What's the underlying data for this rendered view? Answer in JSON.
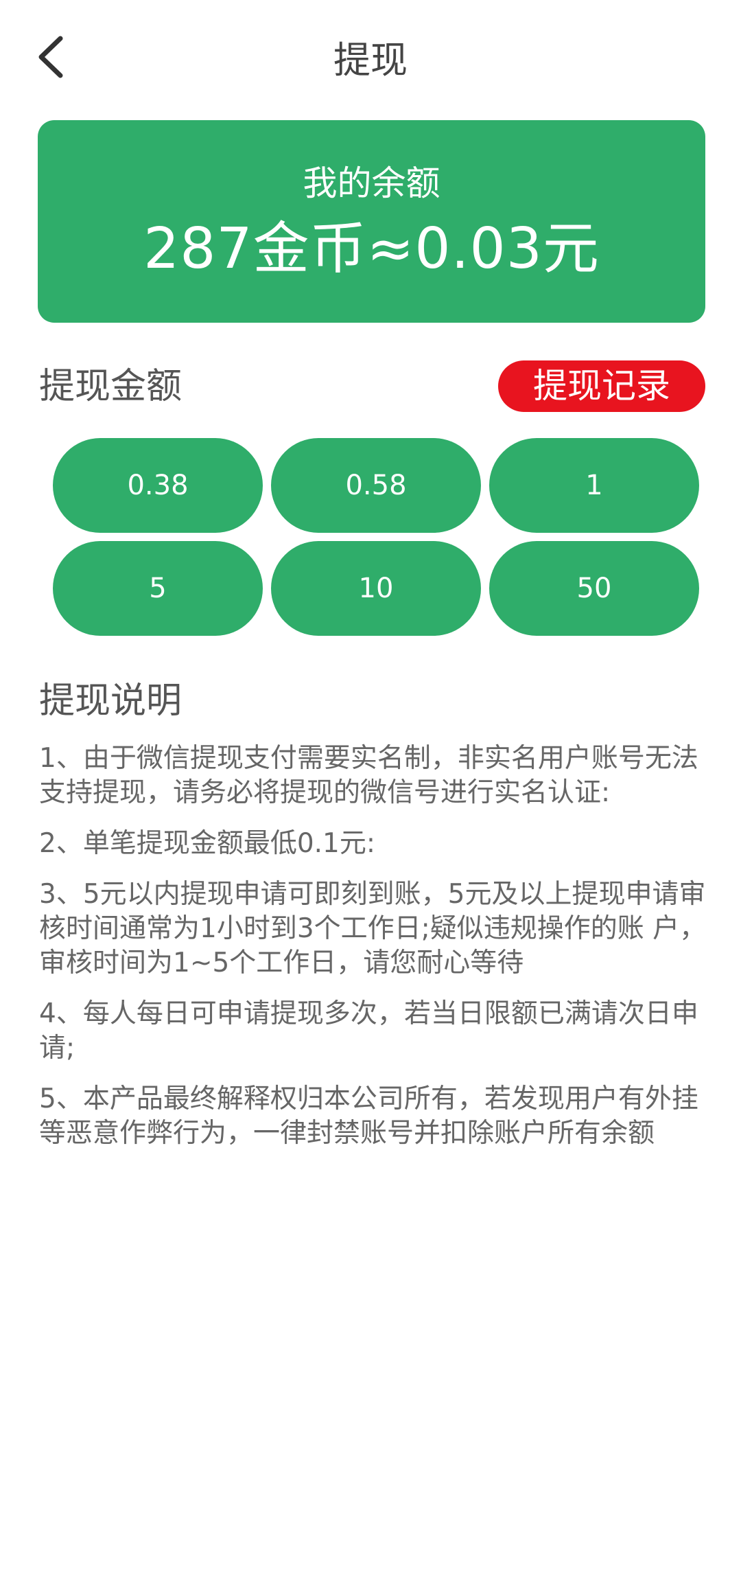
{
  "header": {
    "title": "提现",
    "back_icon": "chevron-left-icon"
  },
  "balance": {
    "label": "我的余额",
    "value": "287金币≈0.03元"
  },
  "amount_section": {
    "title": "提现金额",
    "records_label": "提现记录",
    "options": [
      "0.38",
      "0.58",
      "1",
      "5",
      "10",
      "50"
    ]
  },
  "description": {
    "title": "提现说明",
    "items": [
      "1、由于微信提现支付需要实名制，非实名用户账号无法支持提现，请务必将提现的微信号进行实名认证:",
      "2、单笔提现金额最低0.1元:",
      "3、5元以内提现申请可即刻到账，5元及以上提现申请审核时间通常为1小时到3个工作日;疑似违规操作的账 户，审核时间为1~5个工作日，请您耐心等待",
      "4、每人每日可申请提现多次，若当日限额已满请次日申请;",
      "5、本产品最终解释权归本公司所有，若发现用户有外挂等恶意作弊行为，一律封禁账号并扣除账户所有余额"
    ]
  },
  "colors": {
    "primary_green": "#2fad6a",
    "records_red": "#e8141f",
    "text_gray": "#555555"
  }
}
